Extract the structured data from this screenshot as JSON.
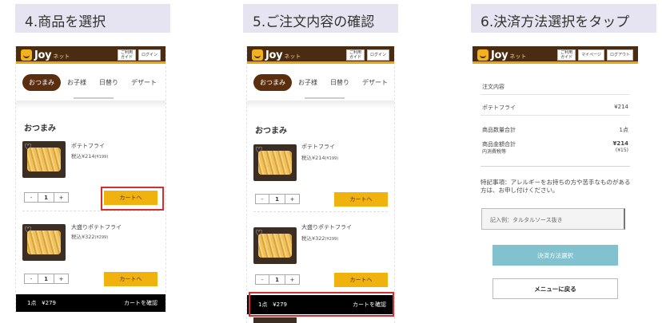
{
  "steps": {
    "step4": "4.商品を選択",
    "step5": "5.ご注文内容の確認",
    "step6": "6.決済方法選択をタップ"
  },
  "header": {
    "logo": "Joy",
    "logo_sub": "ネット",
    "guide_button": "ご利用\nガイド",
    "login_button": "ログイン",
    "mypage_button": "マイページ",
    "logout_button": "ログアウト"
  },
  "tabs": [
    "おつまみ",
    "お子様",
    "日替り",
    "デザート"
  ],
  "section_title": "おつまみ",
  "items": [
    {
      "name": "ポテトフライ",
      "price": "税込¥214",
      "price_note": "(¥199)",
      "qty": "1",
      "minus": "-",
      "plus": "+",
      "cart_button": "カートへ"
    },
    {
      "name": "大盛りポテトフライ",
      "price": "税込¥322",
      "price_note": "(¥299)",
      "qty": "1",
      "minus": "-",
      "plus": "+",
      "cart_button": "カートへ"
    }
  ],
  "bottom_bar": {
    "count": "1点",
    "total": "¥279",
    "confirm": "カートを確認"
  },
  "order": {
    "heading": "注文内容",
    "item_name": "ポテトフライ",
    "item_price": "¥214",
    "qty_label": "商品数量合計",
    "qty_value": "1点",
    "total_label": "商品金額合計",
    "total_value": "¥214",
    "tax_label": "内消費税等",
    "tax_value": "(¥15)",
    "note": "特記事項：アレルギーをお持ちの方や苦手なものがある方は、お申し付けください。",
    "input_placeholder": "記入例：タルタルソース抜き",
    "pay_button": "決済方法選択",
    "back_button": "メニューに戻る"
  },
  "colors": {
    "brand_brown": "#4a2c12",
    "accent_yellow": "#f0b20f",
    "highlight_red": "#d32f2f",
    "pay_teal": "#82c2cf"
  }
}
